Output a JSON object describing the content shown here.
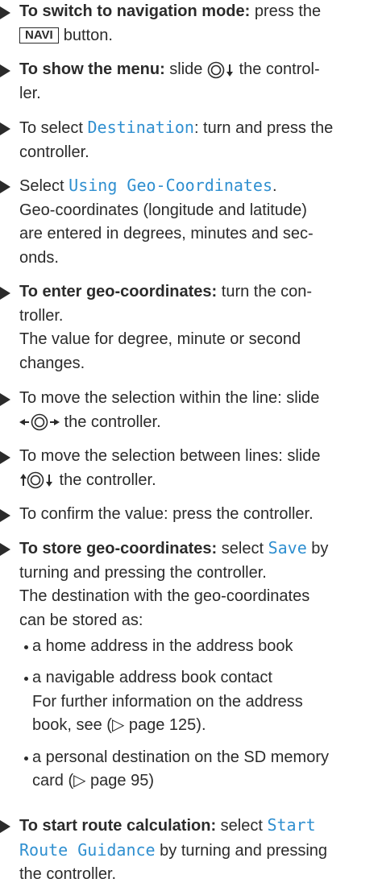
{
  "steps": {
    "s1": {
      "lead": "To switch to navigation mode:",
      "text1": " press the",
      "key": "NAVI",
      "text2": "button."
    },
    "s2": {
      "lead": "To show the menu:",
      "text1": " slide",
      "text2": " the control-",
      "text3": "ler."
    },
    "s3": {
      "text1": "To select ",
      "mono": "Destination",
      "text2": ": turn and press the",
      "text3": "controller."
    },
    "s4": {
      "text1": "Select ",
      "mono": "Using Geo-Coordinates",
      "text2": ".",
      "lines": [
        "Geo-coordinates (longitude and latitude)",
        "are entered in degrees, minutes and sec-",
        "onds."
      ]
    },
    "s5": {
      "lead": "To enter geo-coordinates:",
      "text1": " turn the con-",
      "text2": "troller.",
      "lines": [
        "The value for degree, minute or second",
        "changes."
      ]
    },
    "s6": {
      "text1": "To move the selection within the line: slide",
      "text2": " the controller."
    },
    "s7": {
      "text1": "To move the selection between lines: slide",
      "text2": " the controller."
    },
    "s8": {
      "text1": "To confirm the value: press the controller."
    },
    "s9": {
      "lead": "To store geo-coordinates:",
      "text1": " select ",
      "mono": "Save",
      "text2": " by",
      "text3": "turning and pressing the controller.",
      "lines": [
        "The destination with the geo-coordinates",
        "can be stored as:"
      ],
      "bullets": {
        "b1": "a home address in the address book",
        "b2": "a navigable address book contact",
        "b2_note1": "For further information on the address",
        "b2_note2": "book, see (▷ page 125).",
        "b3_line1": "a personal destination on the SD memory",
        "b3_line2": "card (▷ page 95)"
      }
    },
    "s10": {
      "lead": "To start route calculation:",
      "text1": " select ",
      "mono1": "Start",
      "mono2": "Route Guidance",
      "text2": " by turning and pressing",
      "text3": "the controller."
    }
  }
}
